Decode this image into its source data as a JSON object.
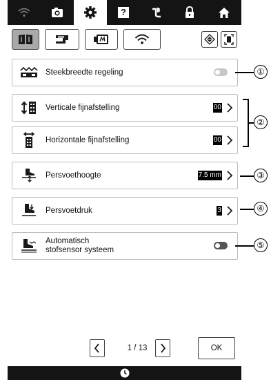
{
  "top_tabs": [
    {
      "icon": "wifi-icon"
    },
    {
      "icon": "camera-icon"
    },
    {
      "icon": "gear-icon",
      "active": true
    },
    {
      "icon": "help-icon",
      "label": "?"
    },
    {
      "icon": "needle-icon"
    },
    {
      "icon": "lock-icon"
    },
    {
      "icon": "home-icon"
    }
  ],
  "sub_tabs": [
    {
      "icon": "manual-icon",
      "active": true
    },
    {
      "icon": "sewing-machine-icon"
    },
    {
      "icon": "embroidery-icon"
    },
    {
      "icon": "wireless-icon"
    }
  ],
  "settings": [
    {
      "label": "Steekbreedte regeling",
      "control": "toggle",
      "on": false,
      "callout": "①"
    },
    {
      "label": "Verticale fijnafstelling",
      "value": "00",
      "callout": "②"
    },
    {
      "label": "Horizontale fijnafstelling",
      "value": "00"
    },
    {
      "label": "Persvoethoogte",
      "value": "7.5 mm",
      "callout": "③"
    },
    {
      "label": "Persvoetdruk",
      "value": "3",
      "callout": "④"
    },
    {
      "label_line1": "Automatisch",
      "label_line2": "stofsensor systeem",
      "control": "toggle",
      "on": true,
      "callout": "⑤"
    }
  ],
  "pager": {
    "text": "1 / 13",
    "current": 1,
    "total": 13
  },
  "ok_label": "OK",
  "colors": {
    "bar": "#141414",
    "toggle_off": "#c8c8c8",
    "toggle_on": "#555555",
    "active_subtab": "#a9a9a9"
  }
}
